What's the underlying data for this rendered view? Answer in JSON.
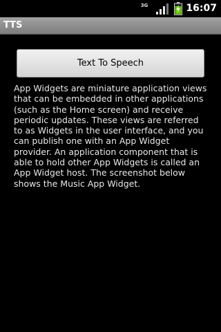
{
  "status_bar": {
    "network_type": "3G",
    "time": "16:07",
    "icons": [
      "network-3g-icon",
      "signal-strength-icon",
      "battery-charging-icon"
    ],
    "colors": {
      "battery_fill": "#66cc00"
    }
  },
  "title_bar": {
    "title": "TTS"
  },
  "main": {
    "button_label": "Text To Speech",
    "description": "App Widgets are miniature application views that can be embedded in other applications (such as the Home screen) and receive periodic updates. These views are referred to as Widgets in the user interface, and you can publish one with an App Widget provider. An application component that is able to hold other App Widgets is called an App Widget host. The screenshot below shows the Music App Widget."
  }
}
